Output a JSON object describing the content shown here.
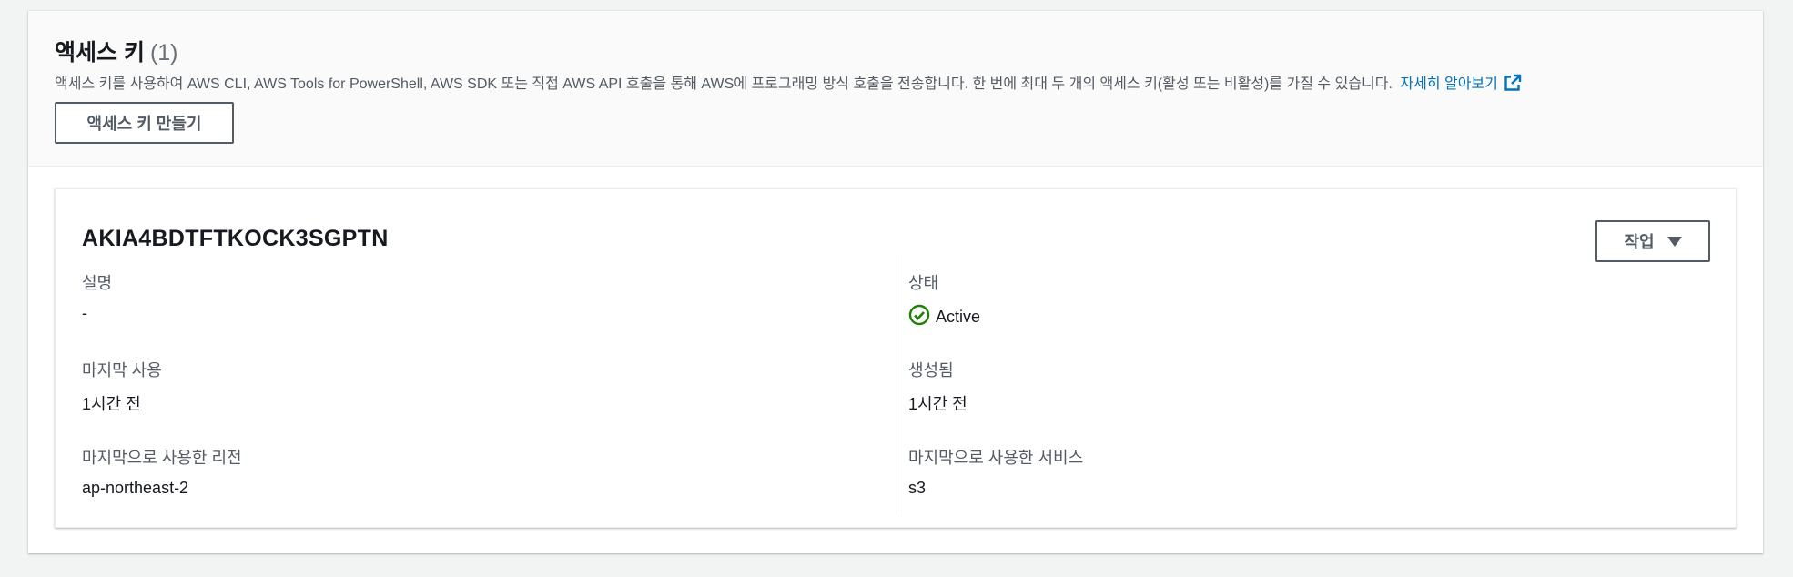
{
  "section": {
    "title": "액세스 키",
    "count": "(1)",
    "description": "액세스 키를 사용하여 AWS CLI, AWS Tools for PowerShell, AWS SDK 또는 직접 AWS API 호출을 통해 AWS에 프로그래밍 방식 호출을 전송합니다. 한 번에 최대 두 개의 액세스 키(활성 또는 비활성)를 가질 수 있습니다.",
    "learn_more": "자세히 알아보기",
    "create_button": "액세스 키 만들기"
  },
  "key": {
    "id": "AKIA4BDTFTKOCK3SGPTN",
    "actions_button": "작업",
    "description_label": "설명",
    "description_value": "-",
    "status_label": "상태",
    "status_value": "Active",
    "status_color": "#1d8102",
    "last_used_label": "마지막 사용",
    "last_used_value": "1시간 전",
    "created_label": "생성됨",
    "created_value": "1시간 전",
    "last_region_label": "마지막으로 사용한 리전",
    "last_region_value": "ap-northeast-2",
    "last_service_label": "마지막으로 사용한 서비스",
    "last_service_value": "s3"
  },
  "icons": {
    "external_link": "external-link-icon",
    "status_ok": "status-positive-icon",
    "caret": "caret-down-icon"
  }
}
